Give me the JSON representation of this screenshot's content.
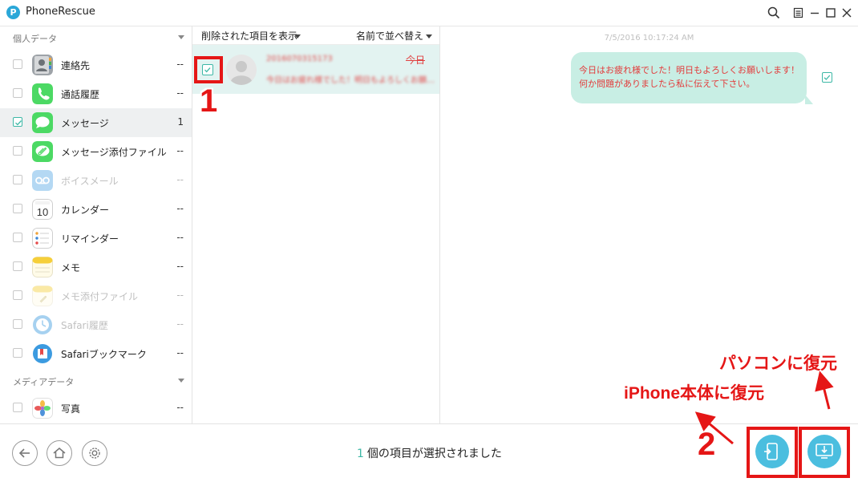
{
  "window": {
    "title": "PhoneRescue",
    "logo_glyph": "P",
    "controls": [
      "search-icon",
      "menu-icon",
      "minimize-icon",
      "maximize-icon",
      "close-icon"
    ]
  },
  "sidebar": {
    "sections": [
      {
        "label": "個人データ"
      },
      {
        "label": "メディアデータ"
      }
    ],
    "items": [
      {
        "label": "連絡先",
        "count": "--",
        "icon": "contacts-icon",
        "checked": false,
        "enabled": true
      },
      {
        "label": "通話履歴",
        "count": "--",
        "icon": "phone-icon",
        "checked": false,
        "enabled": true
      },
      {
        "label": "メッセージ",
        "count": "1",
        "icon": "messages-icon",
        "checked": true,
        "enabled": true
      },
      {
        "label": "メッセージ添付ファイル",
        "count": "--",
        "icon": "attachment-icon",
        "checked": false,
        "enabled": true
      },
      {
        "label": "ボイスメール",
        "count": "--",
        "icon": "voicemail-icon",
        "checked": false,
        "enabled": false
      },
      {
        "label": "カレンダー",
        "count": "--",
        "icon": "calendar-icon",
        "checked": false,
        "enabled": true,
        "icon_text": "10"
      },
      {
        "label": "リマインダー",
        "count": "--",
        "icon": "reminders-icon",
        "checked": false,
        "enabled": true
      },
      {
        "label": "メモ",
        "count": "--",
        "icon": "notes-icon",
        "checked": false,
        "enabled": true
      },
      {
        "label": "メモ添付ファイル",
        "count": "--",
        "icon": "notes-attachment-icon",
        "checked": false,
        "enabled": false
      },
      {
        "label": "Safari履歴",
        "count": "--",
        "icon": "safari-history-icon",
        "checked": false,
        "enabled": false
      },
      {
        "label": "Safariブックマーク",
        "count": "--",
        "icon": "safari-bookmark-icon",
        "checked": false,
        "enabled": true
      },
      {
        "label": "写真",
        "count": "--",
        "icon": "photos-icon",
        "checked": false,
        "enabled": true
      }
    ]
  },
  "list": {
    "filter_label": "削除された項目を表示",
    "sort_label": "名前で並べ替え",
    "rows": [
      {
        "contact": "2016070315173",
        "preview": "今日はお疲れ様でした！明日もよろしくお願…",
        "date": "今日",
        "checked": true
      }
    ]
  },
  "conversation": {
    "timestamp": "7/5/2016 10:17:24 AM",
    "message": "今日はお疲れ様でした！明日もよろしくお願いします！何か問題がありましたら私に伝えて下さい。",
    "checked": true
  },
  "bottom": {
    "status_count": "1",
    "status_text": "個の項目が選択されました",
    "nav": [
      "back-icon",
      "home-icon",
      "settings-icon"
    ],
    "actions": [
      {
        "name": "recover-to-device-button",
        "icon": "device-restore-icon"
      },
      {
        "name": "recover-to-computer-button",
        "icon": "computer-restore-icon"
      }
    ]
  },
  "annotations": {
    "step1": "1",
    "step2": "2",
    "to_device": "iPhone本体に復元",
    "to_computer": "パソコンに復元",
    "color": "#e51616"
  }
}
